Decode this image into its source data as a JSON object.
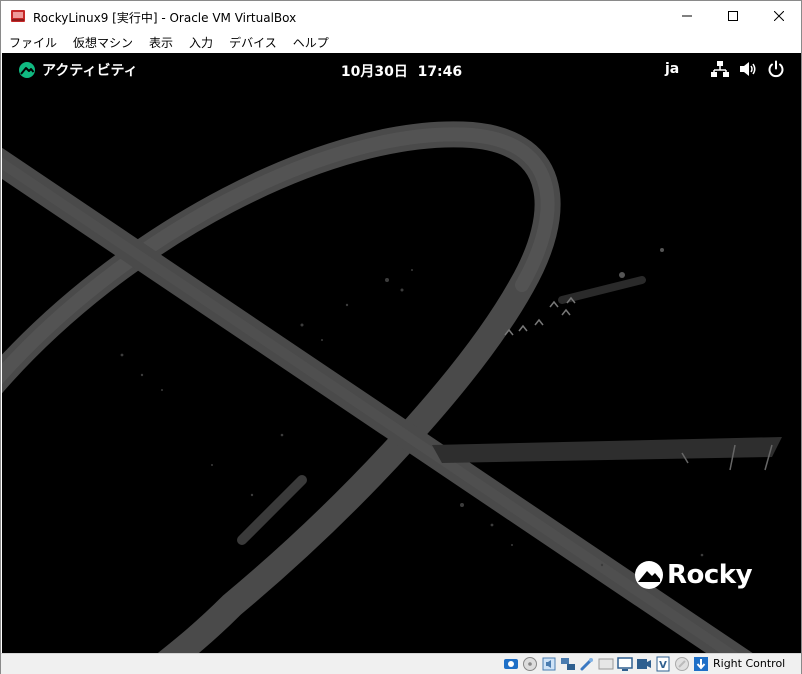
{
  "window": {
    "title": "RockyLinux9 [実行中] - Oracle VM VirtualBox",
    "minimize_glyph": "—",
    "maximize_glyph": "☐",
    "close_glyph": "✕"
  },
  "menubar": {
    "items": [
      "ファイル",
      "仮想マシン",
      "表示",
      "入力",
      "デバイス",
      "ヘルプ"
    ]
  },
  "gnome_topbar": {
    "activities_label": "アクティビティ",
    "clock": "10月30日  17:46",
    "input_language": "ja",
    "icons": [
      "network-icon",
      "volume-icon",
      "power-icon"
    ]
  },
  "wallpaper": {
    "logo_text": "Rocky",
    "accent_color": "#10b981"
  },
  "statusbar": {
    "host_key_label": "Right Control",
    "icons": [
      "hard-disk-icon",
      "optical-drive-icon",
      "audio-icon",
      "network-adapter-icon",
      "usb-icon",
      "shared-folders-icon",
      "display-icon",
      "recording-icon",
      "virtualization-icon",
      "mouse-integration-icon",
      "keyboard-capture-icon"
    ]
  }
}
